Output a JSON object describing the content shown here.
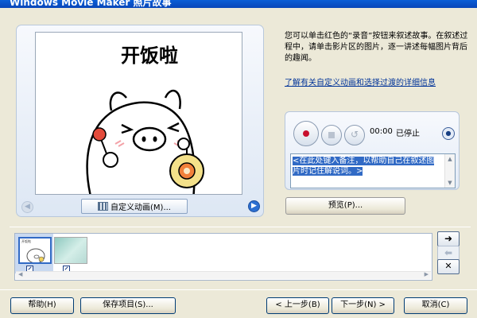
{
  "window": {
    "title": "Windows Movie Maker 照片故事"
  },
  "description": "您可以单击红色的“录音”按钮来叙述故事。在叙述过程中，请单击影片区的图片，逐一讲述每幅图片背后的趣闻。",
  "help_link": "了解有关自定义动画和选择过渡的详细信息",
  "preview": {
    "image_caption": "开饭啦",
    "custom_animation_label": "自定义动画(M)...",
    "prev_icon": "chevron-left-icon",
    "next_icon": "chevron-right-icon"
  },
  "narration": {
    "time": "00:00",
    "status": "已停止",
    "notes_placeholder": "<在此处键入备注，以帮助自己在叙述图片时记住解说词。>"
  },
  "preview_button": "预览(P)...",
  "storyboard": {
    "thumbnails": [
      {
        "caption": "开饭啦",
        "selected": true
      },
      {
        "caption": "",
        "selected": false
      }
    ]
  },
  "footer": {
    "help": "帮助(H)",
    "save": "保存项目(S)...",
    "back": "< 上一步(B)",
    "next": "下一步(N) >",
    "cancel": "取消(C)"
  },
  "colors": {
    "record": "#c8102e",
    "accent": "#316ac5",
    "link": "#003399"
  }
}
